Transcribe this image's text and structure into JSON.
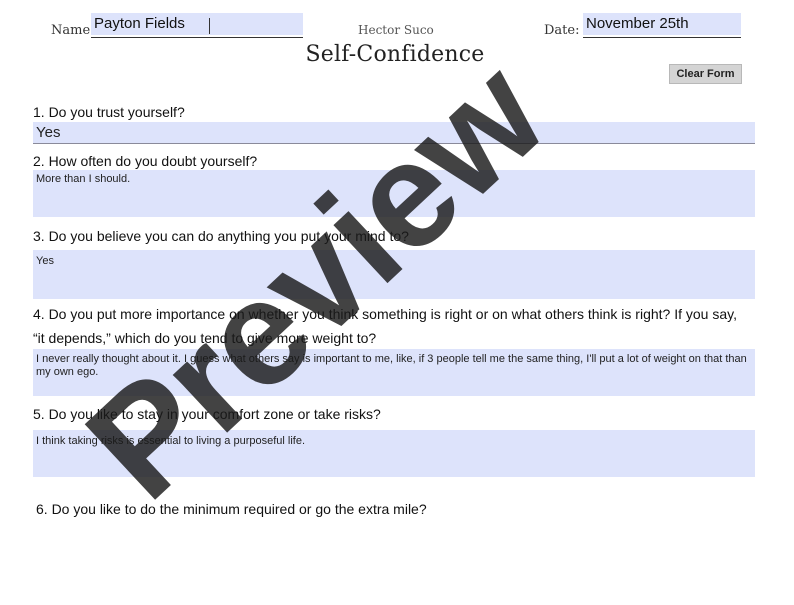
{
  "header": {
    "name_label": "Name:",
    "name_value": "Payton Fields",
    "author": "Hector Suco",
    "date_label": "Date:",
    "date_value": "November 25th",
    "title": "Self-Confidence",
    "clear_button": "Clear Form"
  },
  "questions": [
    {
      "text": "1. Do you trust yourself?",
      "answer": "Yes"
    },
    {
      "text": "2. How often do you doubt yourself?",
      "answer": "More than I should."
    },
    {
      "text": "3. Do you believe you can do anything you put your mind to?",
      "answer": "Yes"
    },
    {
      "text_line1": "4. Do you put more importance on whether you think something is right or on what others think is right? If you say,",
      "text_line2": "“it depends,” which do you tend to give more weight to?",
      "answer": "I never really thought about it. I guess what others say is important to me, like, if 3 people tell me the same thing, I'll put a lot of weight on that than my own ego."
    },
    {
      "text": "5. Do you like to stay in your comfort zone or take risks?",
      "answer": "I think taking risks is essential to living a purposeful life."
    },
    {
      "text": "6. Do you like to do the minimum required or go the extra mile?"
    }
  ],
  "watermark": {
    "text": "Preview",
    "color": "#1a1a1a"
  }
}
